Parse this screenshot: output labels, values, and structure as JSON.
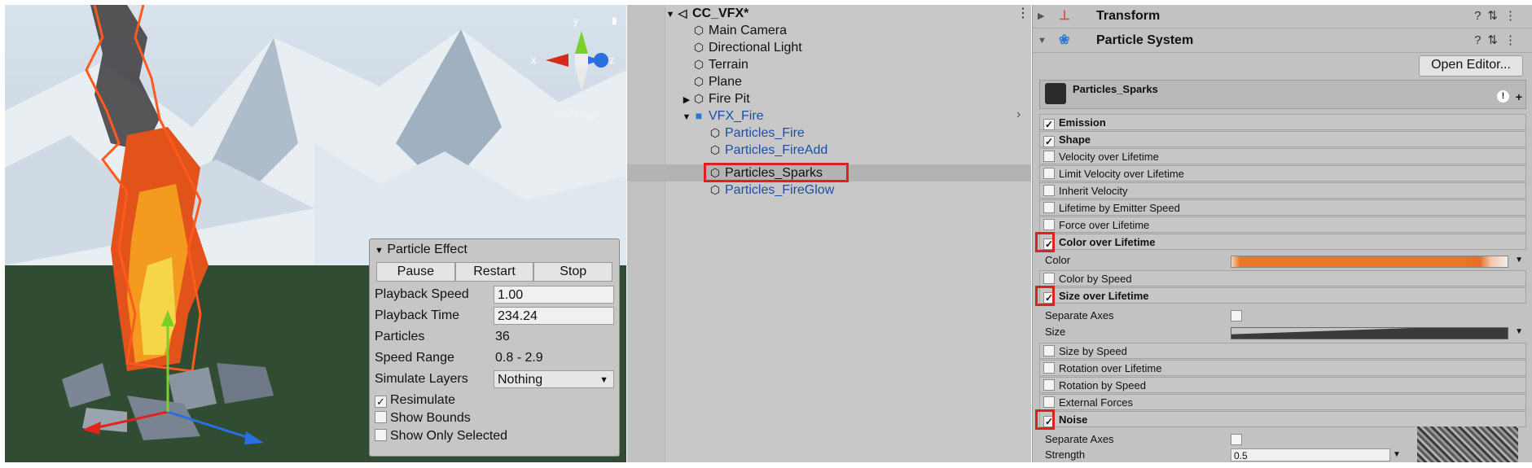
{
  "particle_effect": {
    "title": "Particle Effect",
    "buttons": [
      "Pause",
      "Restart",
      "Stop"
    ],
    "playback_speed_label": "Playback Speed",
    "playback_speed": "1.00",
    "playback_time_label": "Playback Time",
    "playback_time": "234.24",
    "particles_label": "Particles",
    "particles": "36",
    "speed_range_label": "Speed Range",
    "speed_range": "0.8 - 2.9",
    "simulate_layers_label": "Simulate Layers",
    "simulate_layers": "Nothing",
    "resimulate": "Resimulate",
    "show_bounds": "Show Bounds",
    "show_only_selected": "Show Only Selected"
  },
  "scene": {
    "gizmo_x": "x",
    "gizmo_y": "y",
    "gizmo_z": "z",
    "persp": "Persp"
  },
  "hierarchy": {
    "root": "CC_VFX*",
    "items": [
      {
        "label": "Main Camera",
        "color": "#111111"
      },
      {
        "label": "Directional Light",
        "color": "#111111"
      },
      {
        "label": "Terrain",
        "color": "#111111"
      },
      {
        "label": "Plane",
        "color": "#111111"
      },
      {
        "label": "Fire Pit",
        "color": "#111111"
      },
      {
        "label": "VFX_Fire",
        "color": "#1a4fa8"
      },
      {
        "label": "Particles_Fire",
        "color": "#1a4fa8"
      },
      {
        "label": "Particles_FireAdd",
        "color": "#1a4fa8"
      },
      {
        "label": "Particles_Sparks",
        "color": "#111111"
      },
      {
        "label": "Particles_FireGlow",
        "color": "#1a4fa8"
      }
    ]
  },
  "inspector": {
    "transform": "Transform",
    "particle_system": "Particle System",
    "open_editor": "Open Editor...",
    "system_name": "Particles_Sparks",
    "modules": [
      {
        "label": "Emission",
        "checked": true,
        "bold": true
      },
      {
        "label": "Shape",
        "checked": true,
        "bold": true
      },
      {
        "label": "Velocity over Lifetime",
        "checked": false,
        "bold": false
      },
      {
        "label": "Limit Velocity over Lifetime",
        "checked": false,
        "bold": false
      },
      {
        "label": "Inherit Velocity",
        "checked": false,
        "bold": false
      },
      {
        "label": "Lifetime by Emitter Speed",
        "checked": false,
        "bold": false
      },
      {
        "label": "Force over Lifetime",
        "checked": false,
        "bold": false
      },
      {
        "label": "Color over Lifetime",
        "checked": true,
        "bold": true
      },
      {
        "label": "Color by Speed",
        "checked": false,
        "bold": false
      },
      {
        "label": "Size over Lifetime",
        "checked": true,
        "bold": true
      },
      {
        "label": "Size by Speed",
        "checked": false,
        "bold": false
      },
      {
        "label": "Rotation over Lifetime",
        "checked": false,
        "bold": false
      },
      {
        "label": "Rotation by Speed",
        "checked": false,
        "bold": false
      },
      {
        "label": "External Forces",
        "checked": false,
        "bold": false
      },
      {
        "label": "Noise",
        "checked": true,
        "bold": true
      }
    ],
    "color_label": "Color",
    "separate_axes_label": "Separate Axes",
    "size_label": "Size",
    "noise_separate_axes_label": "Separate Axes",
    "strength_label": "Strength",
    "strength_value": "0.5",
    "gradient_color": "#e8792a"
  }
}
